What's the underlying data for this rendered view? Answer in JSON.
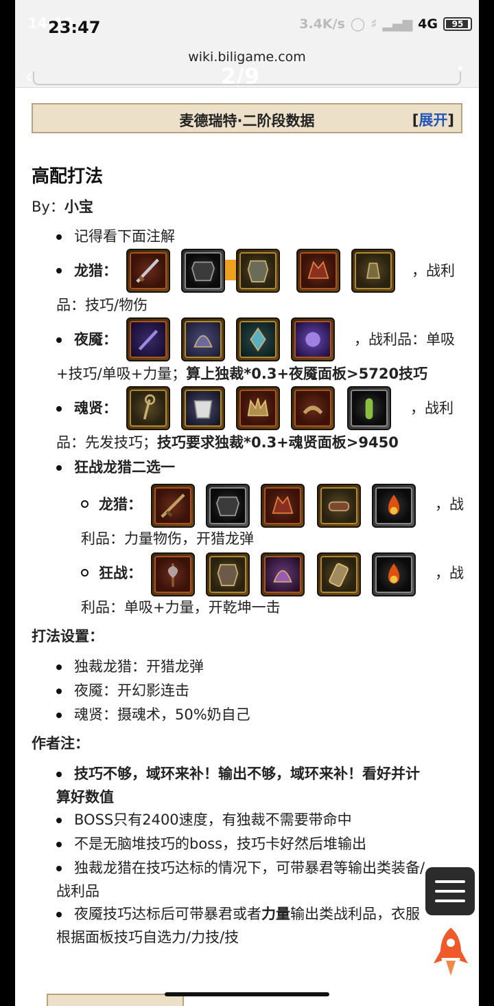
{
  "status_bar": {
    "time_ghost": "14:19",
    "time": "23:47",
    "speed": "3.4K/s",
    "network": "4G",
    "battery": "95"
  },
  "browser": {
    "url": "wiki.biligame.com",
    "page_counter": "2/9"
  },
  "section_header": {
    "title": "麦德瑞特·二阶段数据",
    "expand_open": "[",
    "expand_label": "展开",
    "expand_close": "]"
  },
  "article": {
    "heading": "高配打法",
    "by_label": "By：",
    "by_name": "小宝",
    "note_item": "记得看下面注解",
    "dragon_label": "龙猎：",
    "dragon_tail": "，战利",
    "dragon_loot": "品：技巧/物伤",
    "night_label": "夜魇：",
    "night_tail": "，战利品：单吸",
    "night_loot_plain": "+技巧/单吸+力量；",
    "night_loot_bold": "算上独裁*0.3+夜魇面板>5720技巧",
    "soul_label": "魂贤：",
    "soul_tail": "，战利",
    "soul_loot_plain": "品：先发技巧；",
    "soul_loot_bold": "技巧要求独裁*0.3+魂贤面板>9450",
    "choice_label": "狂战龙猎二选一",
    "sub_dragon_label": "龙猎：",
    "sub_dragon_tail": "，战",
    "sub_dragon_loot": "利品：力量物伤，开猎龙弹",
    "sub_berserk_label": "狂战：",
    "sub_berserk_tail": "，战",
    "sub_berserk_loot": "利品：单吸+力量，开乾坤一击",
    "settings_heading": "打法设置：",
    "settings": [
      "独裁龙猎：开猎龙弹",
      "夜魇：开幻影连击",
      "魂贤：摄魂术，50%奶自己"
    ],
    "author_heading": "作者注：",
    "author_note_1a": "技巧不够，域环来补！输出不够，域环来补！看好并计",
    "author_note_1b": "算好数值",
    "author_note_2": "BOSS只有2400速度，有独裁不需要带命中",
    "author_note_3": "不是无脑堆技巧的boss，技巧卡好然后堆输出",
    "author_note_4a": "独裁龙猎在技巧达标的情况下，可带暴君等输出类装备/",
    "author_note_4b": "战利品",
    "author_note_5a_pre": "夜魇技巧达标后可带暴君或者",
    "author_note_5a_bold": "力量",
    "author_note_5a_post": "输出类战利品，衣服",
    "author_note_5b": "根据面板技巧自选力/力技/技"
  },
  "icons": {
    "dragon": [
      "sword-icon",
      "armor-icon",
      "chest-icon",
      "dragon-head-icon",
      "bell-icon"
    ],
    "night": [
      "dagger-icon",
      "helm-icon",
      "gem-icon",
      "aura-icon"
    ],
    "soul": [
      "staff-icon",
      "mask-icon",
      "crown-icon",
      "claw-icon",
      "cactus-icon"
    ],
    "sub_dragon": [
      "rifle-icon",
      "armor-icon",
      "dragon-head-icon",
      "bracer-icon",
      "fire-icon"
    ],
    "sub_berserk": [
      "axe-icon",
      "chest-icon",
      "helm-icon",
      "scroll-icon",
      "fire-icon"
    ]
  },
  "colors": {
    "accent": "#2455b6",
    "header_bg": "#ede0c8",
    "band": "#f0a020"
  }
}
